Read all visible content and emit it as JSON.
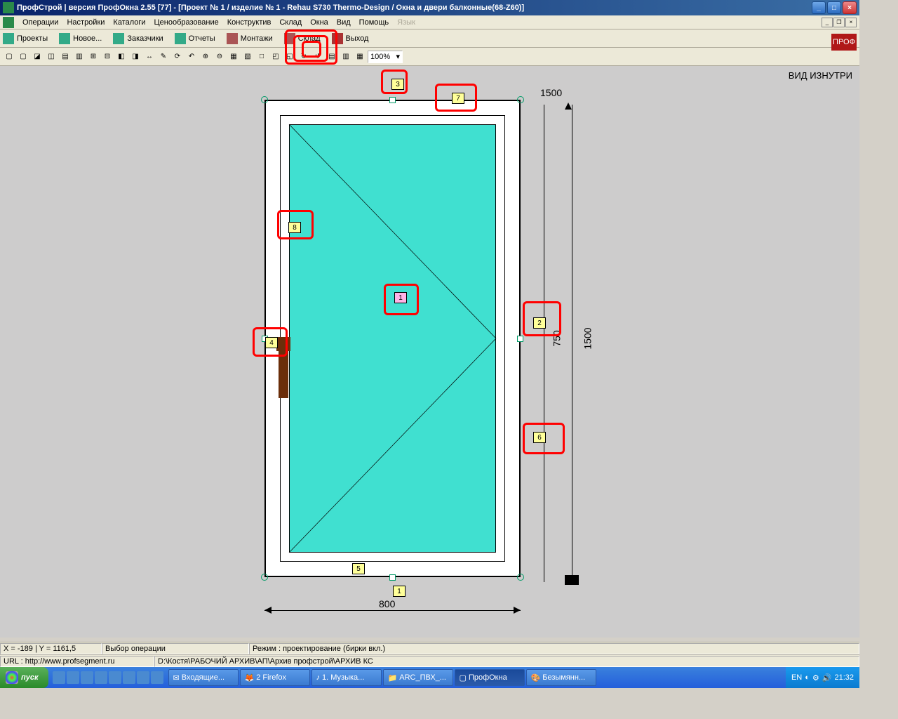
{
  "title": "ПрофСтрой | версия ПрофОкна  2.55 [77] - [Проект № 1 / изделие № 1  -  Rehau S730 Thermo-Design / Окна и двери балконные(68-Z60)]",
  "menu": {
    "m1": "Операции",
    "m2": "Настройки",
    "m3": "Каталоги",
    "m4": "Ценообразование",
    "m5": "Конструктив",
    "m6": "Склад",
    "m7": "Окна",
    "m8": "Вид",
    "m9": "Помощь",
    "m10": "Язык"
  },
  "tb": {
    "projects": "Проекты",
    "new": "Новое...",
    "customers": "Заказчики",
    "reports": "Отчеты",
    "installs": "Монтажи",
    "warehouse": "Склад",
    "exit": "Выход"
  },
  "zoom": "100%",
  "view_label": "ВИД ИЗНУТРИ",
  "dims": {
    "top": "1500",
    "right_top": "1500",
    "right_mid": "750",
    "bottom": "800"
  },
  "tags": {
    "t1": "1",
    "t2": "2",
    "t3": "3",
    "t4": "4",
    "t5": "5",
    "t6": "6",
    "t7": "7",
    "t8": "8",
    "b1": "1"
  },
  "status": {
    "coords": "X = -189 | Y = 1161,5",
    "op": "Выбор операции",
    "mode": "Режим : проектирование  (бирки вкл.)",
    "url": "URL : http://www.profsegment.ru",
    "path": "D:\\Костя\\РАБОЧИЙ АРХИВ\\АП\\Архив профстрой\\АРХИВ КС"
  },
  "taskbar": {
    "start": "пуск",
    "t1": "Входящие...",
    "t2": "2 Firefox",
    "t3": "1. Музыка...",
    "t4": "ARC_ПВХ_...",
    "t5": "ПрофОкна",
    "t6": "Безымянн...",
    "lang": "EN",
    "time": "21:32"
  },
  "logo": "ПРОФ"
}
